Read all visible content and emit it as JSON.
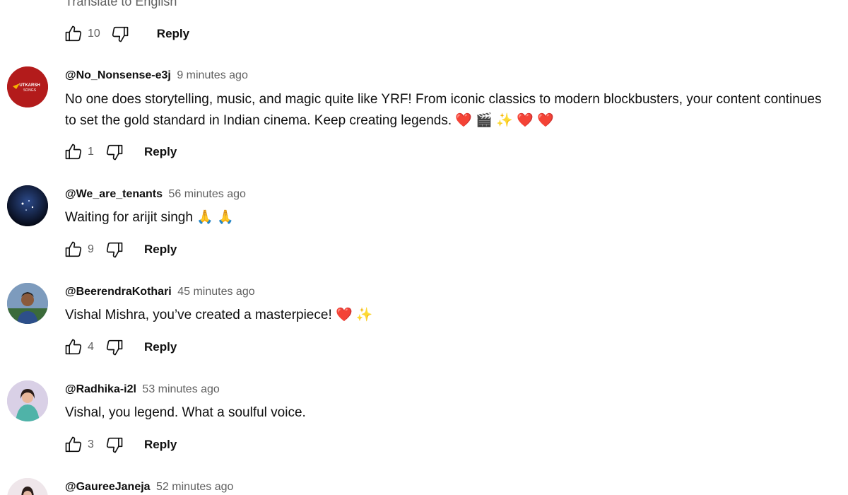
{
  "top": {
    "translate_label": "Translate to English",
    "like_count": "10",
    "reply_label": "Reply"
  },
  "comments": [
    {
      "author": "@No_Nonsense-e3j",
      "time": "9 minutes ago",
      "text": "No one does storytelling, music, and magic quite like YRF! From iconic classics to modern blockbusters, your content continues to set the gold standard in Indian cinema. Keep creating legends. ❤️ 🎬 ✨ ❤️ ❤️",
      "likes": "1",
      "reply_label": "Reply",
      "avatar_text": "UTKARSH SONGS"
    },
    {
      "author": "@We_are_tenants",
      "time": "56 minutes ago",
      "text": "Waiting for arijit singh 🙏 🙏",
      "likes": "9",
      "reply_label": "Reply"
    },
    {
      "author": "@BeerendraKothari",
      "time": "45 minutes ago",
      "text": "Vishal Mishra, you’ve created a masterpiece! ❤️ ✨",
      "likes": "4",
      "reply_label": "Reply"
    },
    {
      "author": "@Radhika-i2l",
      "time": "53 minutes ago",
      "text": "Vishal, you legend. What a soulful voice.",
      "likes": "3",
      "reply_label": "Reply"
    },
    {
      "author": "@GaureeJaneja",
      "time": "52 minutes ago"
    }
  ],
  "colors": {
    "text_primary": "#0f0f0f",
    "text_secondary": "#606060",
    "avatar_1_bg": "#b31b1b"
  },
  "icons": {
    "like": "thumbs-up-icon",
    "dislike": "thumbs-down-icon"
  }
}
